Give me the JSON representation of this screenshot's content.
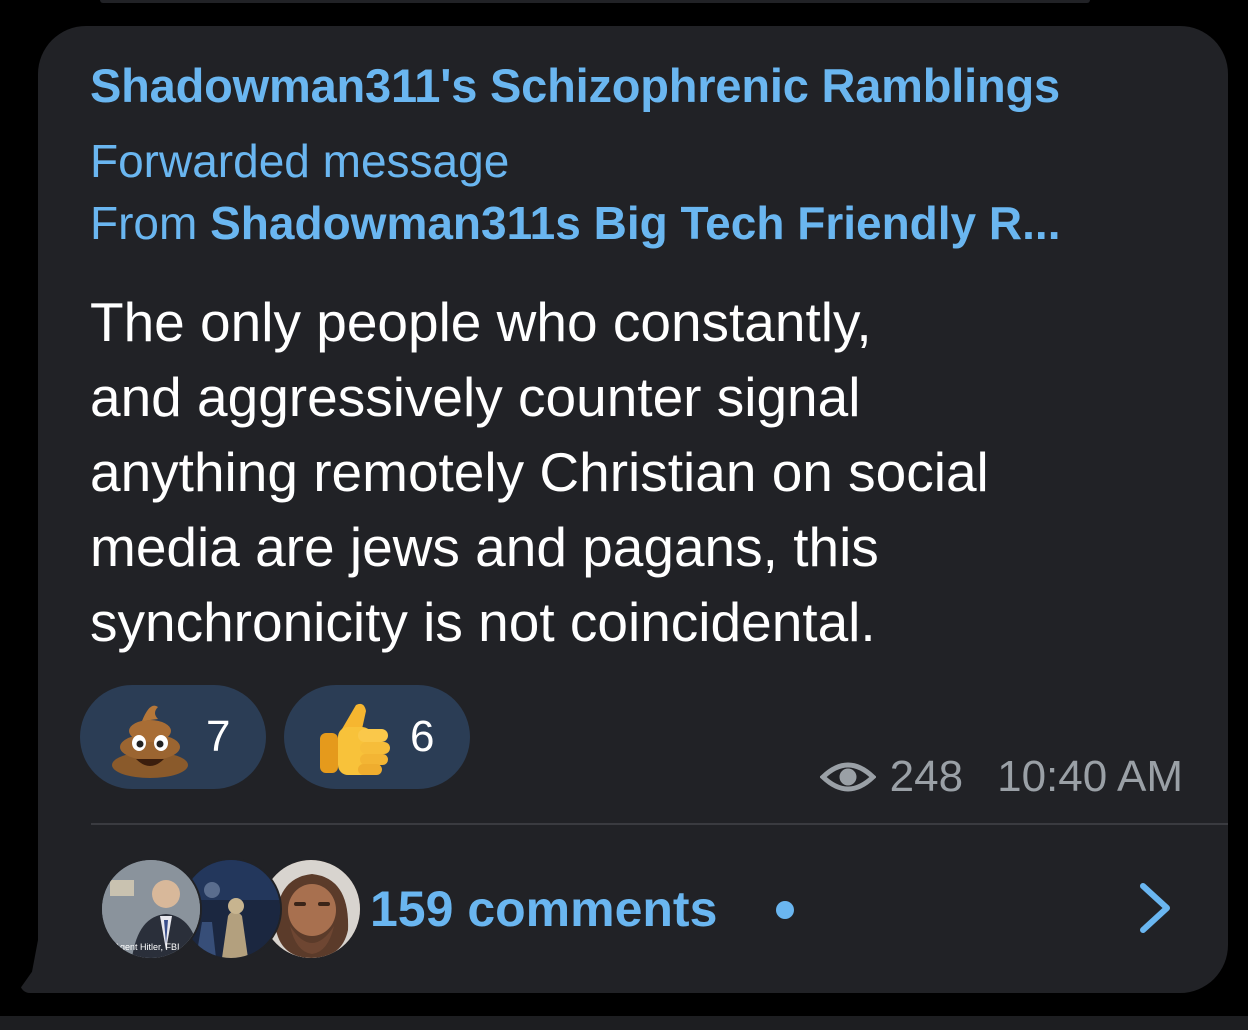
{
  "message": {
    "channel_title": "Shadowman311's Schizophrenic Ramblings",
    "forward_label": "Forwarded message",
    "forward_from_prefix": "From",
    "forward_source": "Shadowman311s Big Tech Friendly R...",
    "text_lines": [
      "The only people who constantly,",
      "and aggressively counter signal",
      "anything remotely Christian on social",
      "media are jews and pagans, this",
      "synchronicity is not coincidental."
    ],
    "reactions": [
      {
        "emoji_icon": "poop-emoji-icon",
        "count": "7"
      },
      {
        "emoji_icon": "thumbs-up-emoji-icon",
        "count": "6"
      }
    ],
    "views": "248",
    "time": "10:40 AM"
  },
  "comments": {
    "label": "159 comments",
    "avatar_icons": [
      "commenter-avatar-1",
      "commenter-avatar-2",
      "commenter-avatar-3"
    ],
    "avatar_caption": "Agent Hitler, FBI"
  },
  "colors": {
    "background": "#000000",
    "bubble": "#212226",
    "accent": "#6ab6f0",
    "text": "#ffffff",
    "meta": "#9aa0a6",
    "reaction_bg": "#2b3d55"
  }
}
